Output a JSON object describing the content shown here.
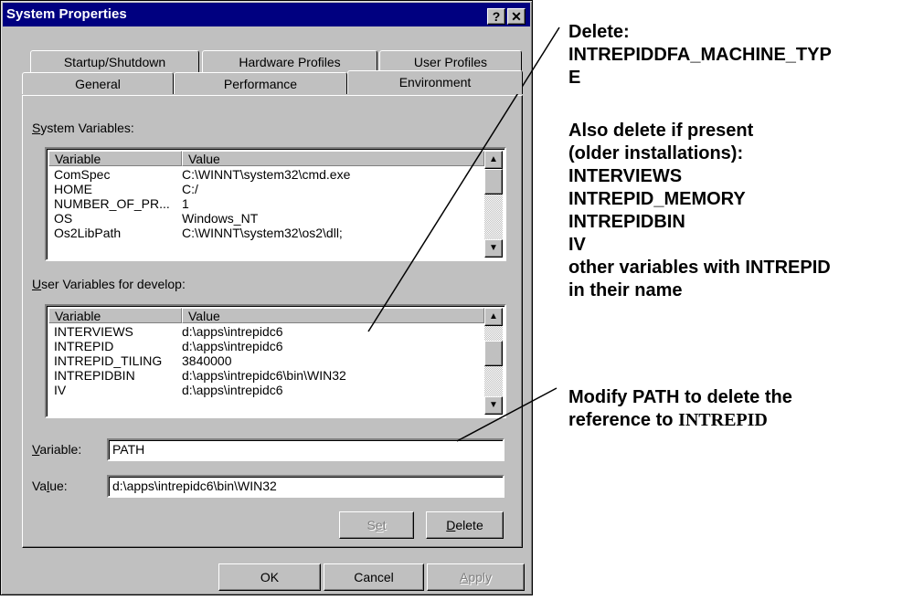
{
  "window": {
    "title": "System Properties",
    "help_button": "?",
    "close_button": "✕"
  },
  "tabs": {
    "back_row": [
      "Startup/Shutdown",
      "Hardware Profiles",
      "User Profiles"
    ],
    "front_row": [
      "General",
      "Performance",
      "Environment"
    ],
    "active": "Environment"
  },
  "system_vars": {
    "label_u": "S",
    "label_rest": "ystem Variables:",
    "columns": [
      "Variable",
      "Value"
    ],
    "rows": [
      {
        "name": "ComSpec",
        "value": "C:\\WINNT\\system32\\cmd.exe"
      },
      {
        "name": "HOME",
        "value": "C:/"
      },
      {
        "name": "NUMBER_OF_PR...",
        "value": "1"
      },
      {
        "name": "OS",
        "value": "Windows_NT"
      },
      {
        "name": "Os2LibPath",
        "value": "C:\\WINNT\\system32\\os2\\dll;"
      }
    ]
  },
  "user_vars": {
    "label_u": "U",
    "label_rest": "ser Variables for develop:",
    "columns": [
      "Variable",
      "Value"
    ],
    "rows": [
      {
        "name": "INTERVIEWS",
        "value": "d:\\apps\\intrepidc6"
      },
      {
        "name": "INTREPID",
        "value": "d:\\apps\\intrepidc6"
      },
      {
        "name": "INTREPID_TILING",
        "value": "3840000"
      },
      {
        "name": "INTREPIDBIN",
        "value": "d:\\apps\\intrepidc6\\bin\\WIN32"
      },
      {
        "name": "IV",
        "value": "d:\\apps\\intrepidc6"
      }
    ]
  },
  "variable_field": {
    "label_u": "V",
    "label_rest": "ariable:",
    "value": "PATH"
  },
  "value_field": {
    "label_pre": "Va",
    "label_u": "l",
    "label_rest": "ue:",
    "value": "d:\\apps\\intrepidc6\\bin\\WIN32"
  },
  "buttons": {
    "set": {
      "pre": "S",
      "u": "e",
      "rest": "t"
    },
    "delete": {
      "u": "D",
      "rest": "elete"
    },
    "ok": "OK",
    "cancel": "Cancel",
    "apply": {
      "u": "A",
      "rest": "pply"
    }
  },
  "annotations": {
    "delete_block": [
      "Delete:",
      "INTREPIDDFA_MACHINE_TYP",
      "E"
    ],
    "also_block": [
      "Also delete if present",
      "(older installations):",
      "INTERVIEWS",
      "INTREPID_MEMORY",
      "INTREPIDBIN",
      "IV",
      "other variables with INTREPID",
      "in their name"
    ],
    "modify_line1": "Modify PATH to delete the",
    "modify_line2_pre": "reference to ",
    "modify_line2_serif": "INTREPID"
  }
}
